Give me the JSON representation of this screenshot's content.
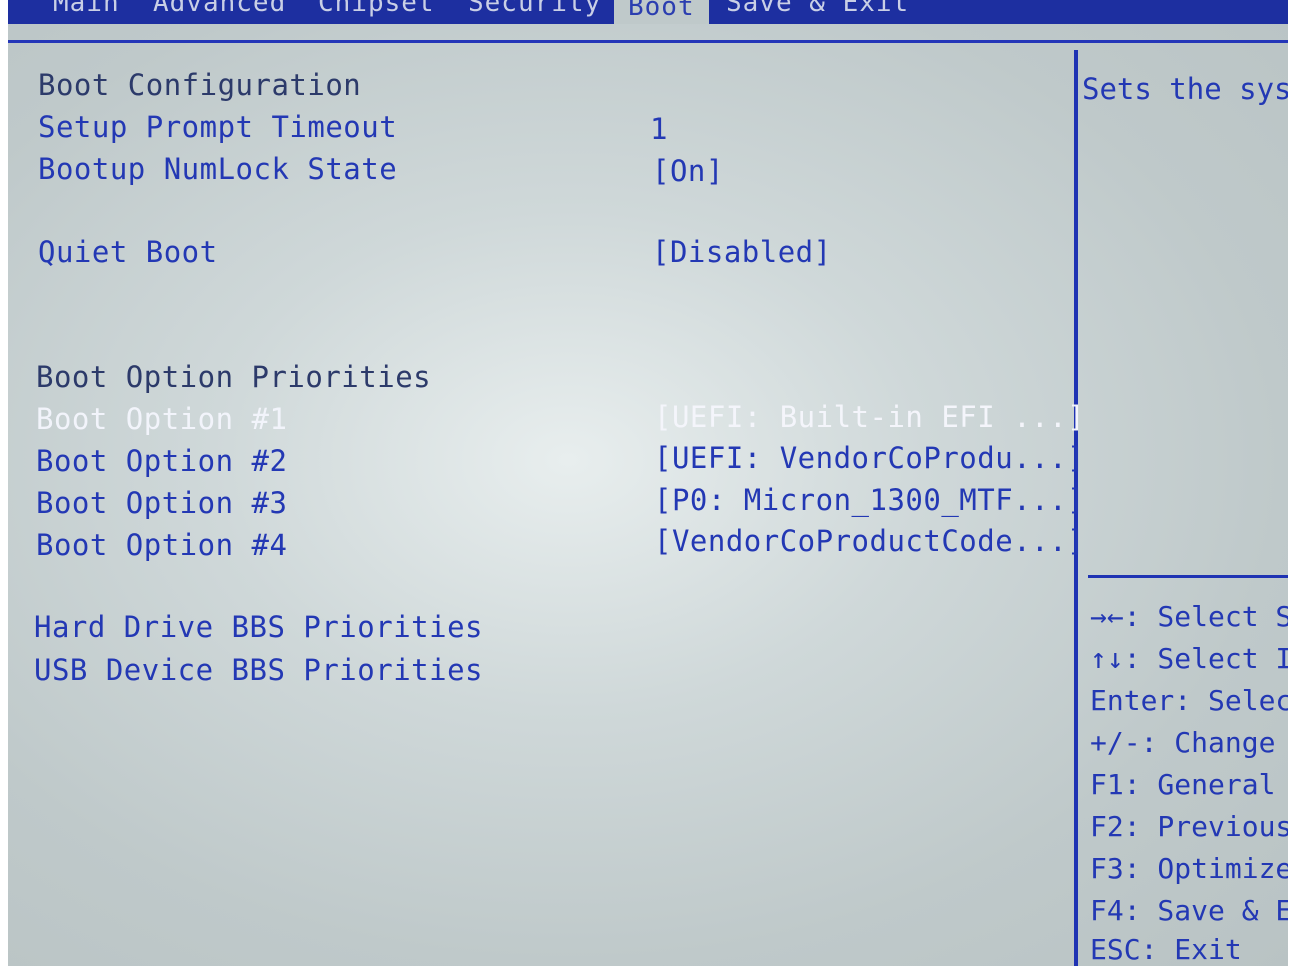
{
  "menubar": {
    "tabs": [
      {
        "label": "Main"
      },
      {
        "label": "Advanced"
      },
      {
        "label": "Chipset"
      },
      {
        "label": "Security"
      },
      {
        "label": "Boot"
      },
      {
        "label": "Save & Exit"
      }
    ],
    "active": "Boot"
  },
  "boot": {
    "section_config": "Boot Configuration",
    "setup_prompt_timeout": {
      "label": "Setup Prompt Timeout",
      "value": "1"
    },
    "numlock": {
      "label": "Bootup NumLock State",
      "value": "[On]"
    },
    "quiet_boot": {
      "label": "Quiet Boot",
      "value": "[Disabled]"
    },
    "section_priorities": "Boot Option Priorities",
    "options": [
      {
        "label": "Boot Option #1",
        "value": "[UEFI: Built-in EFI ...]"
      },
      {
        "label": "Boot Option #2",
        "value": "[UEFI: VendorCoProdu...]"
      },
      {
        "label": "Boot Option #3",
        "value": "[P0: Micron_1300_MTF...]"
      },
      {
        "label": "Boot Option #4",
        "value": "[VendorCoProductCode...]"
      }
    ],
    "hdd_bbs": "Hard Drive BBS Priorities",
    "usb_bbs": "USB Device BBS Priorities"
  },
  "help": {
    "description": "Sets the syst",
    "keys": [
      "→←: Select Sc",
      "↑↓: Select I",
      "Enter: Selec",
      "+/-: Change",
      "F1: General",
      "F2: Previous",
      "F3: Optimize",
      "F4: Save & E",
      "ESC: Exit"
    ]
  },
  "colors": {
    "accent_blue": "#2338b4",
    "menubar_bg": "#1d2fa0",
    "screen_bg": "#bfc9ca",
    "selected_text": "#f2f4fb"
  }
}
